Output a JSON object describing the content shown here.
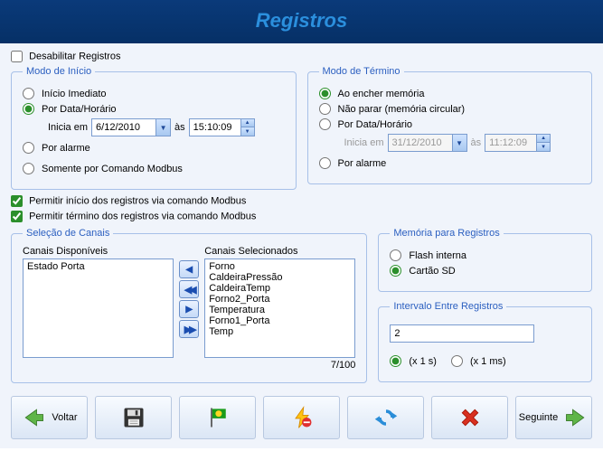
{
  "header": {
    "title": "Registros"
  },
  "disable": {
    "label": "Desabilitar Registros",
    "checked": false
  },
  "start": {
    "legend": "Modo de Início",
    "immediate": "Início Imediato",
    "bydate": "Por Data/Horário",
    "byalarm": "Por alarme",
    "modbus_only": "Somente por Comando Modbus",
    "starts_at": "Inicia em",
    "at": "às",
    "date": "6/12/2010",
    "time": "15:10:09",
    "selected": "bydate"
  },
  "end": {
    "legend": "Modo de Término",
    "fullmem": "Ao encher memória",
    "circular": "Não parar (memória circular)",
    "bydate": "Por Data/Horário",
    "byalarm": "Por alarme",
    "starts_at": "Inicia em",
    "at": "às",
    "date": "31/12/2010",
    "time": "11:12:09",
    "selected": "fullmem"
  },
  "modbus_start": {
    "label": "Permitir início dos registros via comando Modbus",
    "checked": true
  },
  "modbus_end": {
    "label": "Permitir término dos registros via comando Modbus",
    "checked": true
  },
  "channels": {
    "legend": "Seleção de Canais",
    "available_label": "Canais Disponíveis",
    "selected_label": "Canais Selecionados",
    "available": [
      "Estado Porta"
    ],
    "selected": [
      "Forno",
      "CaldeiraPressão",
      "CaldeiraTemp",
      "Forno2_Porta",
      "Temperatura",
      "Forno1_Porta",
      "Temp"
    ],
    "count": "7/100"
  },
  "memory": {
    "legend": "Memória para Registros",
    "flash": "Flash interna",
    "sd": "Cartão SD",
    "selected": "sd"
  },
  "interval": {
    "legend": "Intervalo Entre Registros",
    "value": "2",
    "unit_s": "(x 1 s)",
    "unit_ms": "(x 1 ms)",
    "selected": "s"
  },
  "footer": {
    "back": "Voltar",
    "next": "Seguinte"
  }
}
